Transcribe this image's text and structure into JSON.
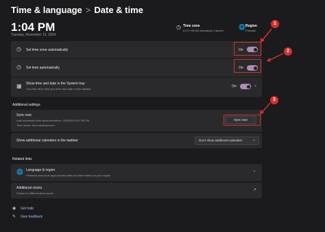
{
  "breadcrumb": {
    "parent": "Time & language",
    "separator": ">",
    "current": "Date & time"
  },
  "clock": {
    "time": "1:04 PM",
    "date": "Tuesday, November 12, 2024"
  },
  "timezone": {
    "label": "Time zone",
    "value": "(UTC+05:00) Islamabad, Karachi"
  },
  "region": {
    "label": "Region",
    "value": "Pakistan"
  },
  "settings": {
    "tz_auto": {
      "title": "Set time zone automatically",
      "state": "On"
    },
    "time_auto": {
      "title": "Set time automatically",
      "state": "On"
    },
    "tray": {
      "title": "Show time and date in the System tray",
      "subtitle": "Turn this off to hide your time and date on the taskbar",
      "state": "On"
    }
  },
  "additional": {
    "heading": "Additional settings",
    "sync": {
      "title": "Sync now",
      "last": "Last successful time synchronization: 11/6/2024 9:07:08 PM",
      "server": "Time server: time.windows.com",
      "button": "Sync now"
    },
    "calendars": {
      "title": "Show additional calendars in the taskbar",
      "selected": "Don't show additional calendars"
    }
  },
  "related": {
    "heading": "Related links",
    "language": {
      "title": "Language & region",
      "subtitle": "Windows and some apps format dates and time based on your region"
    },
    "clocks": {
      "title": "Additional clocks",
      "subtitle": "Clocks for different time zones"
    }
  },
  "footer": {
    "help": "Get help",
    "feedback": "Give feedback"
  },
  "annotations": [
    "1",
    "2",
    "3"
  ],
  "colors": {
    "toggle_on": "#b08ab8",
    "annotation": "#d9302b",
    "background": "#1b1b1d",
    "card": "#2a2a2c"
  },
  "icons": [
    "timezone-icon",
    "globe-icon",
    "clock-sync-icon",
    "clock-icon",
    "calendar-icon",
    "external-link-icon"
  ]
}
